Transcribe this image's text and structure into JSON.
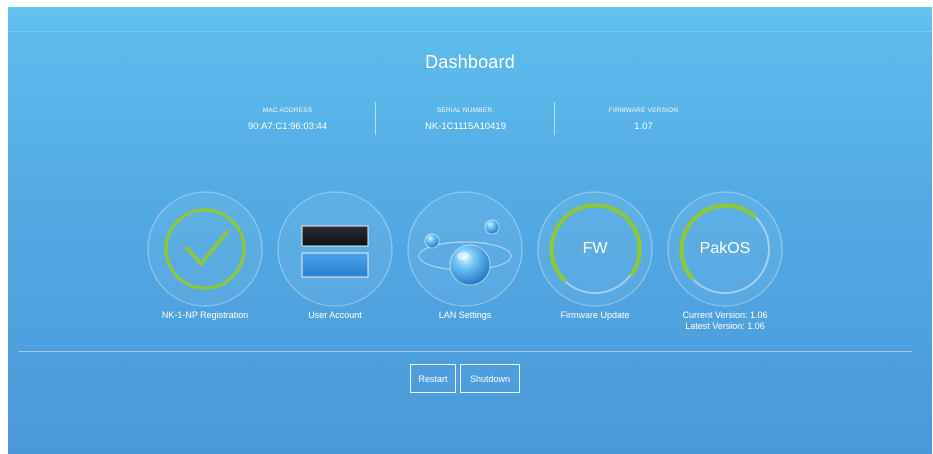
{
  "header": {
    "title": "Dashboard"
  },
  "device_info": [
    {
      "label": "MAC ADDRESS",
      "value": "90:A7:C1:96:03:44"
    },
    {
      "label": "SERIAL NUMBER:",
      "value": "NK-1C1115A10419"
    },
    {
      "label": "FIRMWARE VERSION",
      "value": "1.07"
    }
  ],
  "tiles": {
    "registration": {
      "label": "NK-1-NP Registration",
      "icon": "checkmark-icon"
    },
    "user_account": {
      "label": "User Account",
      "icon": "user-account-icon"
    },
    "lan_settings": {
      "label": "LAN Settings",
      "icon": "water-drops-icon"
    },
    "firmware_update": {
      "label": "Firmware Update",
      "icon_text": "FW"
    },
    "pakos": {
      "icon_text": "PakOS",
      "current_version": "Current Version: 1.06",
      "latest_version": "Latest Version: 1.06"
    }
  },
  "actions": {
    "restart_label": "Restart",
    "shutdown_label": "Shutdown"
  },
  "colors": {
    "accent_green": "#8dc63f",
    "background_top": "#5fbeed",
    "background_bottom": "#4b98d9"
  }
}
